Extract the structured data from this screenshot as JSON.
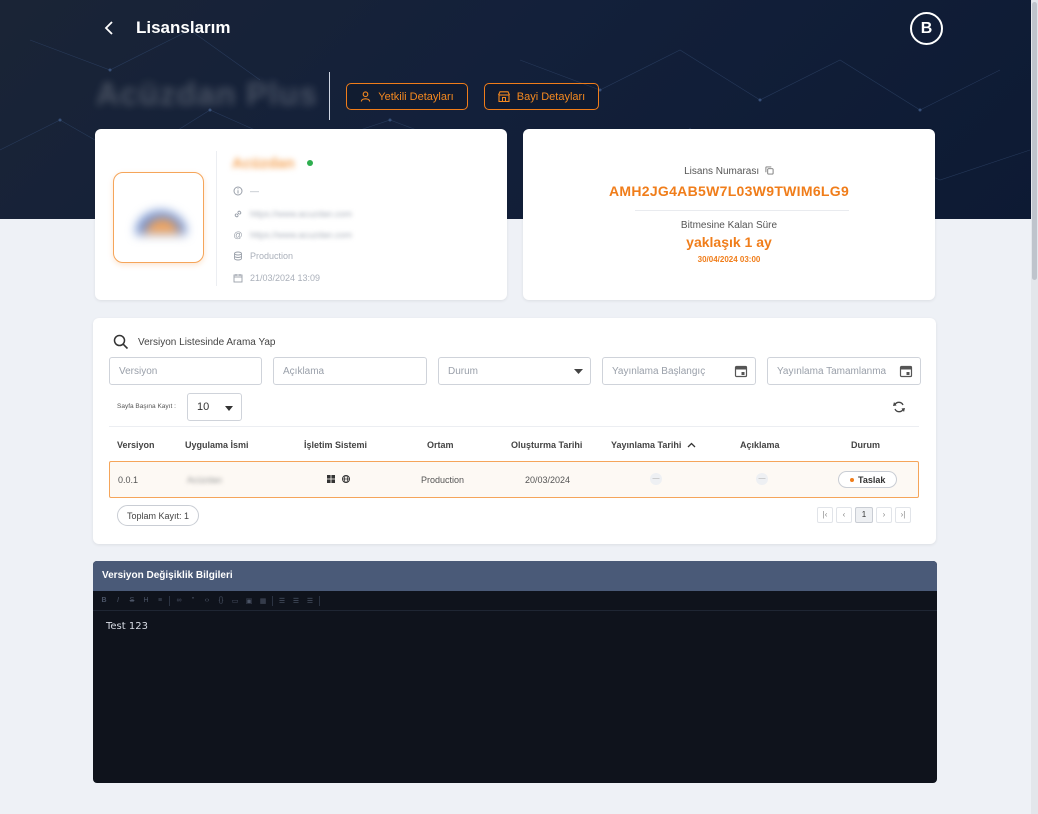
{
  "header": {
    "back_icon": "chevron-left-icon",
    "title": "Lisanslarım",
    "avatar_letter": "B",
    "app_name": "Acüzdan Plus"
  },
  "hero_buttons": {
    "authorized": {
      "label": "Yetkili Detayları",
      "icon": "user-icon"
    },
    "dealer": {
      "label": "Bayi Detayları",
      "icon": "store-icon"
    }
  },
  "app_info": {
    "name": "Acüzdan",
    "status": "online",
    "description": "—",
    "website": "https://www.acuzdan.com",
    "email_site": "https://www.acuzdan.com",
    "environment": "Production",
    "created_at": "21/03/2024 13:09"
  },
  "license": {
    "number_label": "Lisans Numarası",
    "number": "AMH2JG4AB5W7L03W9TWIM6LG9",
    "remaining_label": "Bitmesine Kalan Süre",
    "remaining_value": "yaklaşık 1 ay",
    "expiry_date": "30/04/2024 03:00"
  },
  "search": {
    "title": "Versiyon Listesinde Arama Yap",
    "version_placeholder": "Versiyon",
    "description_placeholder": "Açıklama",
    "status_placeholder": "Durum",
    "publish_start_placeholder": "Yayınlama Başlangıç",
    "publish_end_placeholder": "Yayınlama Tamamlanma",
    "per_page_label": "Sayfa Başına Kayıt :",
    "per_page_value": "10"
  },
  "table": {
    "columns": [
      "Versiyon",
      "Uygulama İsmi",
      "İşletim Sistemi",
      "Ortam",
      "Oluşturma Tarihi",
      "Yayınlama Tarihi",
      "Açıklama",
      "Durum"
    ],
    "rows": [
      {
        "version": "0.0.1",
        "app_name": "Acüzdan",
        "os_icons": [
          "windows-icon",
          "globe-icon"
        ],
        "environment": "Production",
        "created": "20/03/2024",
        "published": "—",
        "description": "—",
        "status": "Taslak"
      }
    ],
    "total_label": "Toplam Kayıt: 1",
    "current_page": "1"
  },
  "editor": {
    "title": "Versiyon Değişiklik Bilgileri",
    "content": "Test 123"
  },
  "colors": {
    "accent": "#f07d1a",
    "hero_bg": "#13203a",
    "editor_header": "#4a5a78",
    "editor_bg": "#0f131c",
    "online": "#2eae4f"
  }
}
